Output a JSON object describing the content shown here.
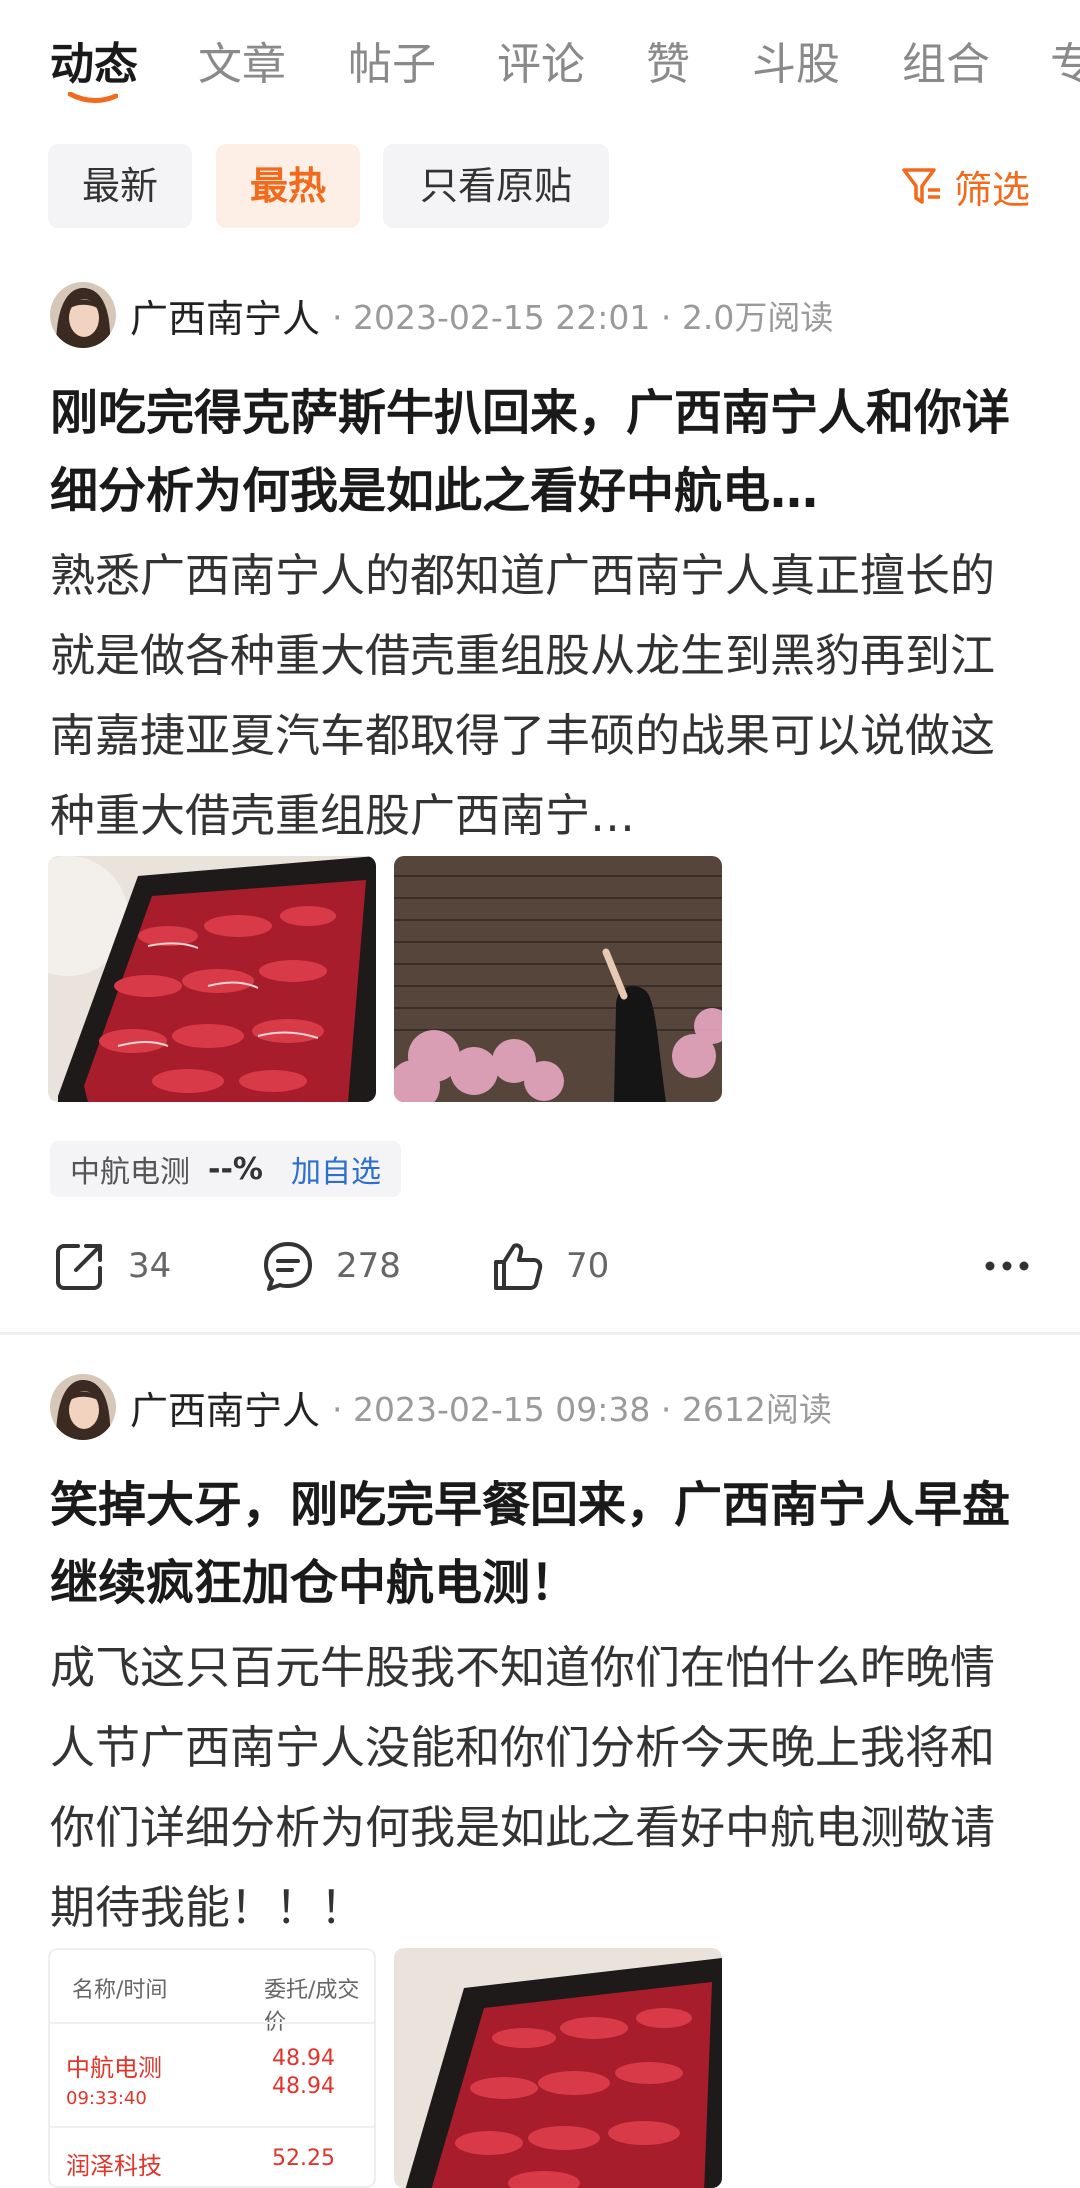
{
  "tabs": [
    {
      "label": "动态",
      "active": true
    },
    {
      "label": "文章",
      "active": false
    },
    {
      "label": "帖子",
      "active": false
    },
    {
      "label": "评论",
      "active": false
    },
    {
      "label": "赞",
      "active": false
    },
    {
      "label": "斗股",
      "active": false
    },
    {
      "label": "组合",
      "active": false
    },
    {
      "label": "专",
      "active": false
    }
  ],
  "filters": {
    "chips": [
      {
        "label": "最新",
        "active": false
      },
      {
        "label": "最热",
        "active": true
      },
      {
        "label": "只看原贴",
        "active": false
      }
    ],
    "filter_label": "筛选"
  },
  "colors": {
    "accent": "#f26a1b",
    "link": "#2d6fd0",
    "stock_red": "#e2342b"
  },
  "posts": [
    {
      "author": "广西南宁人",
      "meta": "· 2023-02-15 22:01 · 2.0万阅读",
      "title": "刚吃完得克萨斯牛扒回来，广西南宁人和你详细分析为何我是如此之看好中航电…",
      "body": "熟悉广西南宁人的都知道广西南宁人真正擅长的就是做各种重大借壳重组股从龙生到黑豹再到江南嘉捷亚夏汽车都取得了丰硕的战果可以说做这种重大借壳重组股广西南宁…",
      "stock_tag": {
        "name": "中航电测",
        "change": "--%",
        "add_label": "加自选"
      },
      "share_count": "34",
      "comment_count": "278",
      "like_count": "70"
    },
    {
      "author": "广西南宁人",
      "meta": "· 2023-02-15 09:38 · 2612阅读",
      "title": "笑掉大牙，刚吃完早餐回来，广西南宁人早盘继续疯狂加仓中航电测！",
      "body": "成飞这只百元牛股我不知道你们在怕什么昨晚情人节广西南宁人没能和你们分析今天晚上我将和你们详细分析为何我是如此之看好中航电测敬请期待我能！！！",
      "order_thumb": {
        "header_left": "名称/时间",
        "header_right": "委托/成交价",
        "rows": [
          {
            "name": "中航电测",
            "time": "09:33:40",
            "price1": "48.94",
            "price2": "48.94"
          },
          {
            "name": "润泽科技",
            "time": "",
            "price1": "52.25",
            "price2": ""
          }
        ]
      }
    }
  ]
}
